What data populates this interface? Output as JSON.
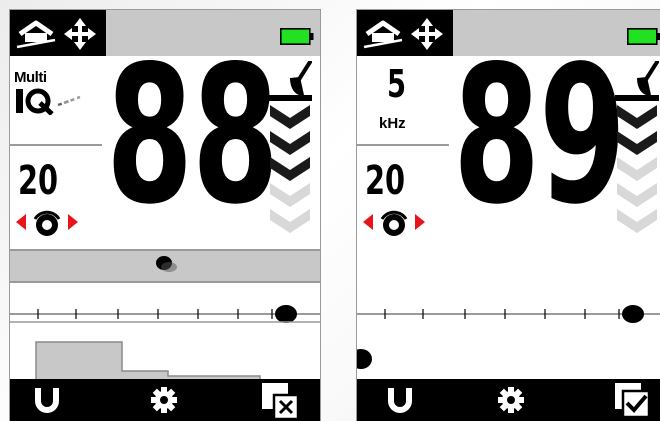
{
  "screens": [
    {
      "id": "left",
      "mode": {
        "label": "Multi",
        "icon": "multi-iq-logo-icon"
      },
      "sensitivity": "20",
      "target_id": "88",
      "depth_segments_on": 3,
      "depth_segments_total": 5,
      "conductivity_bar_highlighted": true,
      "accept_reject": "reject",
      "toolbar_icons": [
        "horseshoe-icon",
        "gear-icon",
        "reject-box-icon"
      ]
    },
    {
      "id": "right",
      "mode": {
        "value": "5",
        "unit": "kHz"
      },
      "sensitivity": "20",
      "target_id": "89",
      "depth_segments_on": 2,
      "depth_segments_total": 5,
      "conductivity_bar_highlighted": false,
      "accept_reject": "accept",
      "toolbar_icons": [
        "horseshoe-icon",
        "gear-icon",
        "accept-box-icon"
      ]
    }
  ],
  "colors": {
    "battery": "#22e022",
    "arrow_red": "#e8141a",
    "bar_gray": "#c8c8c8",
    "depth_on": "#1a1a1a",
    "depth_off": "#d8d8d8"
  },
  "status_icons": [
    "ground-balance-house-icon",
    "pinpoint-move-icon",
    "battery-icon"
  ]
}
